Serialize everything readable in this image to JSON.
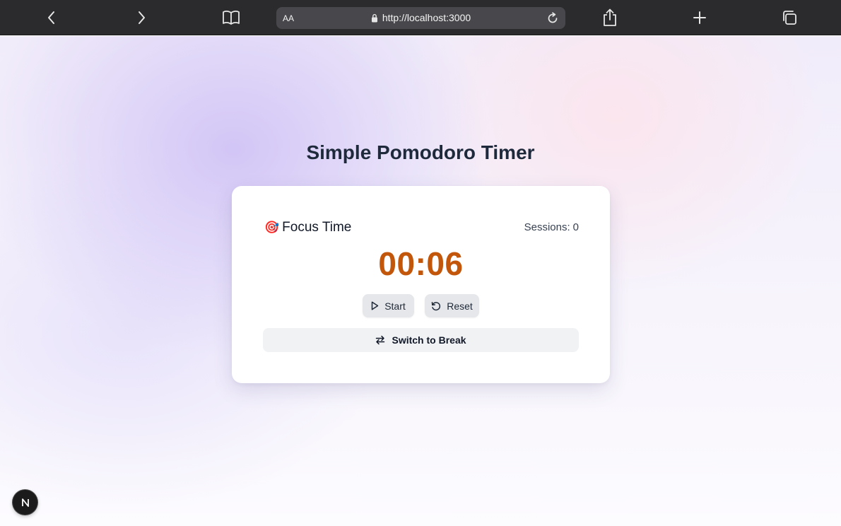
{
  "browser": {
    "text_size_label": "AA",
    "url": "http://localhost:3000"
  },
  "page": {
    "title": "Simple Pomodoro Timer"
  },
  "timer": {
    "mode_emoji": "🎯",
    "mode_label": "Focus Time",
    "sessions_label": "Sessions:",
    "sessions_count": "0",
    "time": "00:06",
    "start_label": "Start",
    "reset_label": "Reset",
    "switch_label": "Switch to Break"
  },
  "colors": {
    "toolbar": "#2b2b2d",
    "time_accent": "#c2570b",
    "title_text": "#1e2a3b"
  },
  "icons": [
    "back-icon",
    "forward-icon",
    "book-icon",
    "lock-icon",
    "reload-icon",
    "share-icon",
    "plus-icon",
    "tabs-icon",
    "play-icon",
    "reset-icon",
    "swap-icon",
    "nextjs-logo-icon"
  ]
}
